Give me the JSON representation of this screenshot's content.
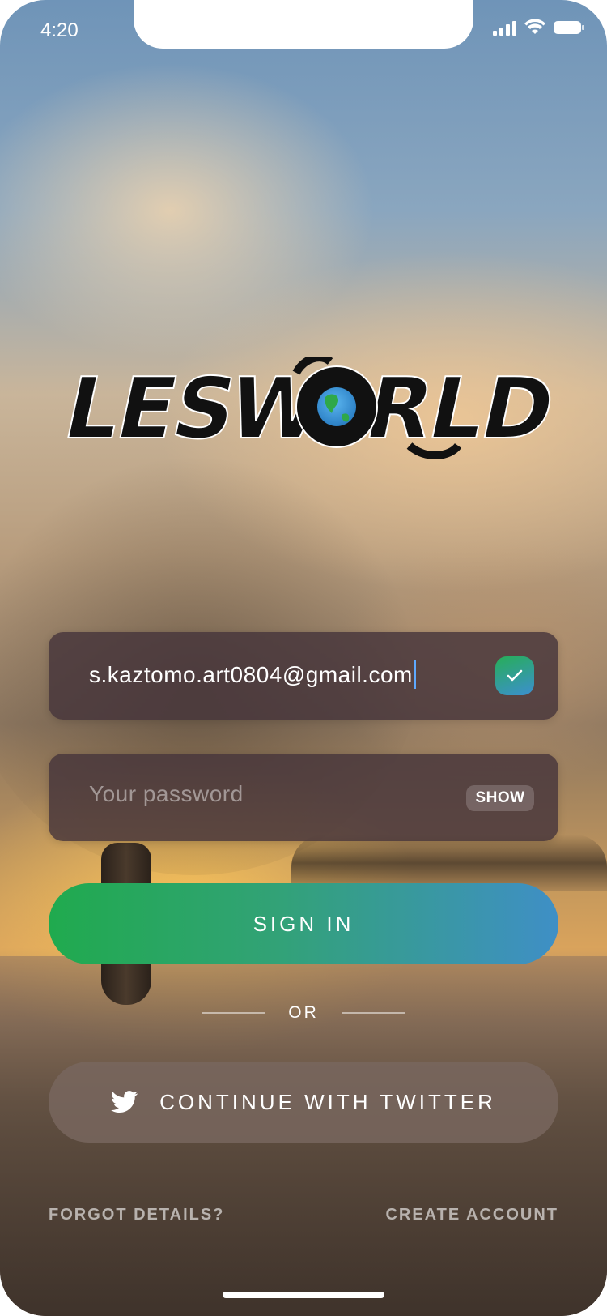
{
  "status_bar": {
    "time": "4:20"
  },
  "logo": {
    "text": "LESWORLD"
  },
  "email_field": {
    "value": "s.kaztomo.art0804@gmail.com",
    "valid_icon": "check-icon"
  },
  "password_field": {
    "placeholder": "Your password",
    "toggle_label": "SHOW"
  },
  "sign_in": {
    "label": "SIGN IN"
  },
  "divider": {
    "label": "OR"
  },
  "twitter": {
    "label": "CONTINUE WITH TWITTER",
    "icon": "twitter-bird-icon"
  },
  "footer": {
    "forgot": "FORGOT DETAILS?",
    "create": "CREATE ACCOUNT"
  },
  "colors": {
    "accent_green": "#20aa4e",
    "accent_blue": "#3f8fc6",
    "field_bg": "#46343a"
  }
}
